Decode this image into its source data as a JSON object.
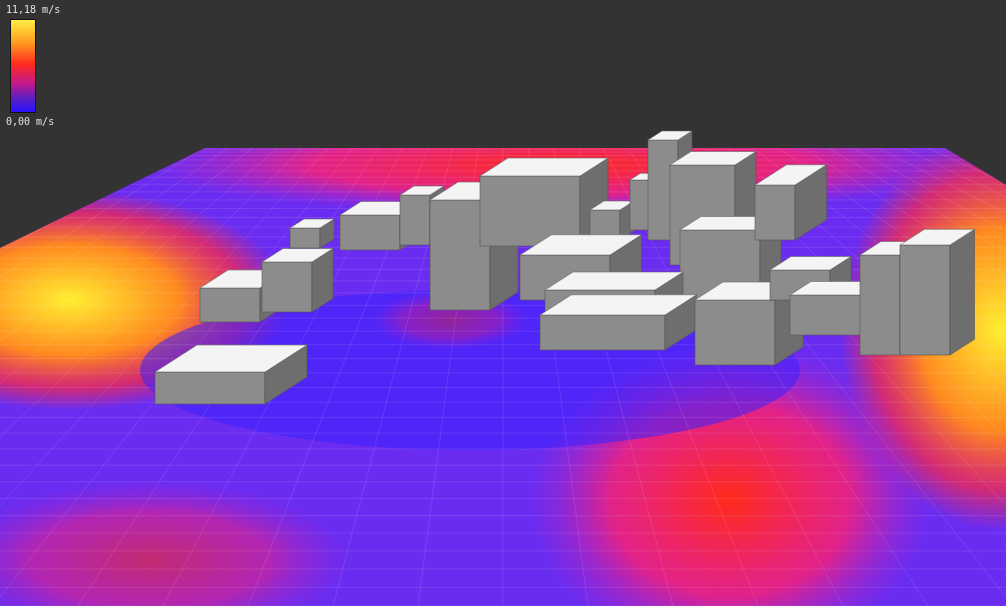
{
  "legend": {
    "max_label": "11,18 m/s",
    "min_label": "0,00 m/s"
  }
}
